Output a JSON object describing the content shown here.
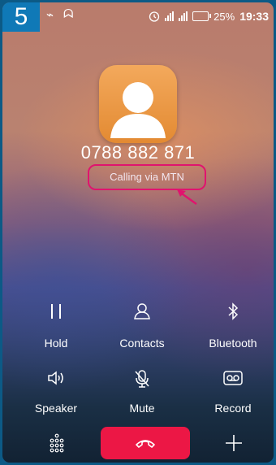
{
  "step_badge": "5",
  "status_bar": {
    "battery_percent": "25%",
    "time": "19:33"
  },
  "call": {
    "number": "0788 882 871",
    "status": "Calling via MTN"
  },
  "controls": {
    "hold": "Hold",
    "contacts": "Contacts",
    "bluetooth": "Bluetooth",
    "speaker": "Speaker",
    "mute": "Mute",
    "record": "Record"
  },
  "colors": {
    "badge": "#0f79b7",
    "highlight": "#e0146e",
    "end_call": "#ec1745",
    "avatar": "#e9933f"
  }
}
